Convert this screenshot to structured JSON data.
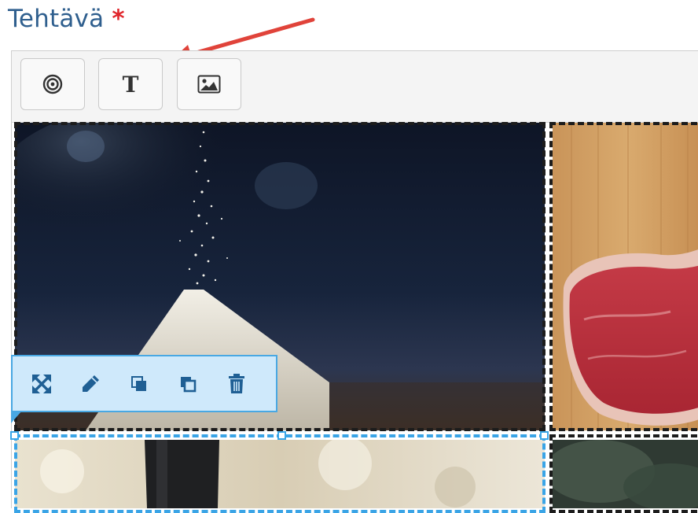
{
  "heading": {
    "text": "Tehtävä",
    "required_mark": "*"
  },
  "colors": {
    "heading": "#2f5f8e",
    "required": "#e0262c",
    "arrow": "#e0433a",
    "selection": "#39a6e8",
    "toolbar_bg": "#cfe9fb"
  },
  "toolbar": {
    "tools": [
      {
        "id": "hotspot",
        "icon": "target-icon",
        "label": ""
      },
      {
        "id": "text",
        "icon": "text-icon",
        "label": "T"
      },
      {
        "id": "image",
        "icon": "image-icon",
        "label": ""
      }
    ]
  },
  "canvas": {
    "images": [
      {
        "id": "sugar",
        "icon": "sugar-photo"
      },
      {
        "id": "steak",
        "icon": "steak-photo"
      },
      {
        "id": "bottle",
        "icon": "bottle-photo"
      },
      {
        "id": "greens",
        "icon": "greens-photo"
      }
    ]
  },
  "context_toolbar": {
    "actions": [
      {
        "id": "resize",
        "icon": "expand-icon"
      },
      {
        "id": "edit",
        "icon": "pencil-icon"
      },
      {
        "id": "bring-forward",
        "icon": "bring-forward-icon"
      },
      {
        "id": "send-backward",
        "icon": "send-backward-icon"
      },
      {
        "id": "delete",
        "icon": "trash-icon"
      }
    ]
  }
}
